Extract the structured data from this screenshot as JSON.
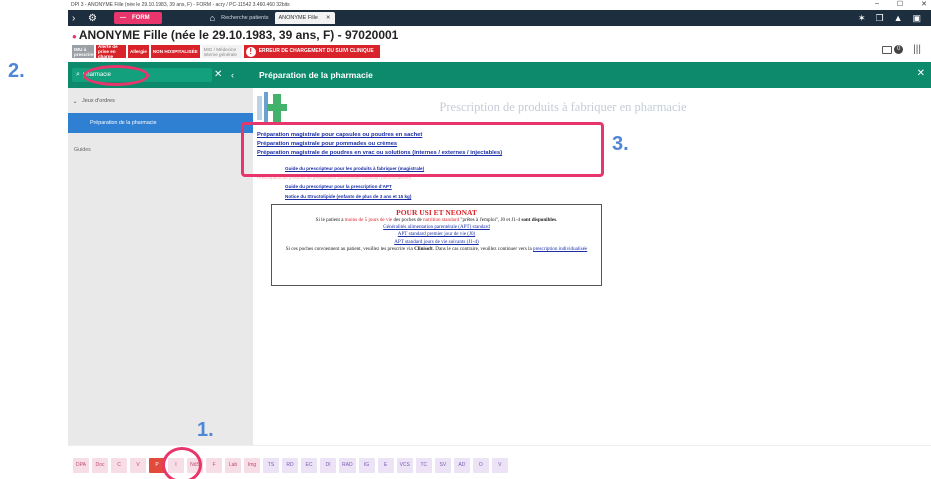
{
  "window": {
    "title": "DPI 3 - ANONYME Fille (née le 29.10.1983, 39 ans, F) - FORM - acry / PC-11542 3.460.460 32bits",
    "controls": [
      "–",
      "☐",
      "✕"
    ]
  },
  "tabs": {
    "form_label": "FORM",
    "search_tab": "Recherche patients",
    "active_tab": "ANONYME Fille",
    "close_glyph": "✕"
  },
  "patient": {
    "name": "ANONYME Fille (née le 29.10.1983, 39 ans, F)  -  97020001",
    "badges": [
      {
        "text": "IMU à prescrire",
        "style": "gray"
      },
      {
        "text": "Alerte de prise en charge",
        "style": "red"
      },
      {
        "text": "Allergie",
        "style": "red"
      },
      {
        "text": "NON HOSPITALISÉE",
        "style": "red"
      },
      {
        "text": "MIG / Médecine interne générale",
        "style": "mid"
      }
    ],
    "error_badge": "ERREUR DE CHARGEMENT DU SUIVI CLINIQUE",
    "notif_count": "0"
  },
  "sidebar": {
    "search_value": "pharmacie",
    "group": "Jeux d'ordres",
    "items": [
      "Préparation de la pharmacie",
      "Guides"
    ]
  },
  "main": {
    "title": "Préparation de la pharmacie",
    "page_heading": "Prescription de produits à fabriquer en pharmacie",
    "links": [
      "Préparation magistrale pour capsules ou poudres en sachet",
      "Préparation magistrale pour pommades ou crèmes",
      "Préparation magistrale de poudres en vrac ou solutions (internes / externes / injectables)"
    ],
    "guides": [
      "Guide du prescripteur pour les produits à fabriquer (magistrale)",
      "Prescription de produits de préparation parentérale (nutrition personnalisée)",
      "Guide du prescripteur pour la prescription d'APT",
      "Notice du Structolipide (enfants de plus de 3 ans et 15 kg)"
    ],
    "infobox": {
      "title": "POUR USI ET NEONAT",
      "line1_a": "Si le patient a",
      "line1_red1": "moins de 5 jours de vie",
      "line1_b": "des poches de",
      "line1_red2": "nutrition standard",
      "line1_c": "\"prêtes à l'emploi\", J0 et J1-4",
      "line1_bold": "sont disponibles",
      "link1": "Généralités alimentation parentérale (APT) standard",
      "link2": "APT standard premier jour de vie (J0)",
      "link3": "APT standard jours de vie suivants (J1-4)",
      "line2_a": "Si ces poches conviennent au patient, veuillez les prescrire via",
      "line2_bold": "Clinisoft",
      "line2_b": ". Dans le cas contraire, veuillez continuer vers la",
      "link4": "prescription individualisée"
    }
  },
  "bottom_buttons": [
    {
      "label": "DPA",
      "style": "pink"
    },
    {
      "label": "Doc",
      "style": "pink"
    },
    {
      "label": "C",
      "style": "pink"
    },
    {
      "label": "V",
      "style": "pink"
    },
    {
      "label": "P",
      "style": "sel"
    },
    {
      "label": "I",
      "style": "pink"
    },
    {
      "label": "NdS",
      "style": "pink"
    },
    {
      "label": "F",
      "style": "pink"
    },
    {
      "label": "Lab",
      "style": "pink"
    },
    {
      "label": "Img",
      "style": "pink"
    },
    {
      "label": "TS",
      "style": "lav"
    },
    {
      "label": "RD",
      "style": "lav"
    },
    {
      "label": "EC",
      "style": "lav"
    },
    {
      "label": "DI",
      "style": "lav"
    },
    {
      "label": "RAD",
      "style": "lav"
    },
    {
      "label": "IG",
      "style": "lav"
    },
    {
      "label": "E",
      "style": "lav"
    },
    {
      "label": "VCS",
      "style": "lav"
    },
    {
      "label": "TC",
      "style": "lav"
    },
    {
      "label": "SV",
      "style": "lav"
    },
    {
      "label": "AD",
      "style": "lav"
    },
    {
      "label": "O",
      "style": "lav"
    },
    {
      "label": "V",
      "style": "lav"
    }
  ],
  "annotations": {
    "step1": "1.",
    "step2": "2.",
    "step3": "3."
  },
  "colors": {
    "accent_green": "#0d8a6c",
    "highlight_pink": "#e8356b",
    "callout_blue": "#4f86d6",
    "selected_item": "#2f7fd3"
  }
}
